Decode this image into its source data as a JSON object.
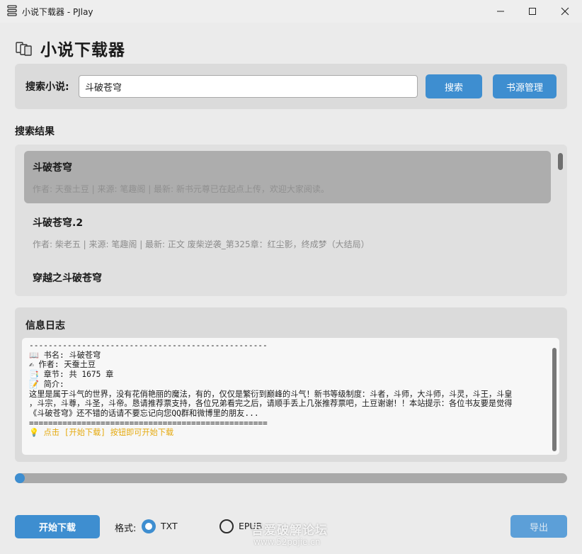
{
  "window": {
    "title": "小说下载器 - PJlay",
    "icon": "stack-icon",
    "controls": [
      "minimize-icon",
      "maximize-icon",
      "close-icon"
    ]
  },
  "header": {
    "title": "小说下载器",
    "icon": "books-icon"
  },
  "search": {
    "label": "搜索小说:",
    "value": "斗破苍穹",
    "search_button": "搜索",
    "source_button": "书源管理"
  },
  "results": {
    "heading": "搜索结果",
    "items": [
      {
        "title": "斗破苍穹",
        "meta": "作者: 天蚕土豆 | 来源: 笔趣阁 | 最新: 新书元尊已在起点上传，欢迎大家阅读。",
        "selected": true
      },
      {
        "title": "斗破苍穹.2",
        "meta": "作者: 柴老五 | 来源: 笔趣阁 | 最新: 正文 废柴逆袭_第325章：红尘影，终成梦（大结局）",
        "selected": false
      },
      {
        "title": "穿越之斗破苍穹",
        "meta": "",
        "selected": false
      }
    ]
  },
  "log": {
    "heading": "信息日志",
    "lines": [
      "--------------------------------------------------",
      "📖 书名: 斗破苍穹",
      "✍ 作者: 天蚕土豆",
      "📑 章节: 共 1675 章",
      "📝 简介:",
      "这里是属于斗气的世界，没有花俏艳丽的魔法，有的，仅仅是繁衍到巅峰的斗气！新书等级制度：斗者，斗师，大斗师，斗灵，斗王，斗皇",
      "，斗宗，斗尊，斗圣，斗帝。恳请推荐票支持，各位兄弟看完之后，请顺手丢上几张推荐票吧，土豆谢谢！！本站提示：各位书友要是觉得",
      "《斗破苍穹》还不错的话请不要忘记向您QQ群和微博里的朋友...",
      "=================================================="
    ],
    "hint": "💡 点击 [开始下载] 按钮即可开始下载"
  },
  "progress": {
    "value": 0
  },
  "footer": {
    "start_button": "开始下载",
    "format_label": "格式:",
    "formats": [
      {
        "label": "TXT",
        "selected": true
      },
      {
        "label": "EPUB",
        "selected": false
      }
    ],
    "export_button": "导出"
  },
  "watermark": {
    "text": "吾爱破解论坛",
    "url": "www.52pojie.cn"
  },
  "colors": {
    "accent": "#3e8ed0",
    "hint": "#e5a90d",
    "panel": "#dbdbdb"
  }
}
